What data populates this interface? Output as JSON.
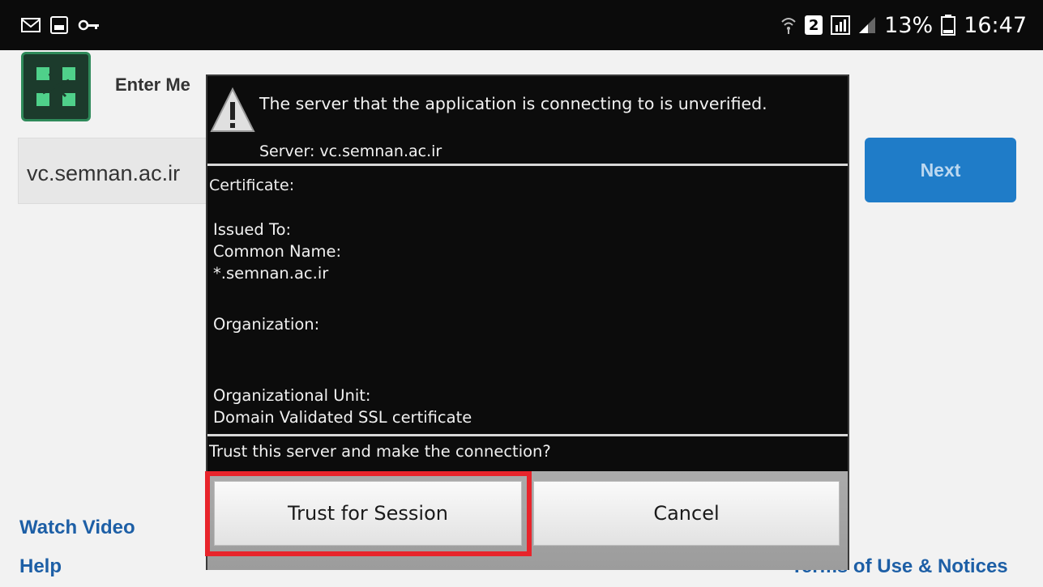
{
  "status_bar": {
    "battery": "13%",
    "time": "16:47",
    "sim_number": "2",
    "left_icons": [
      "mail-icon",
      "image-icon",
      "key-icon"
    ],
    "right_icons": [
      "wifi-icon",
      "sim-icon",
      "data-icon",
      "signal-icon",
      "battery-icon"
    ]
  },
  "app": {
    "title_visible": "Enter Me",
    "url_value": "vc.semnan.ac.ir",
    "next_label": "Next",
    "links": {
      "watch_video": "Watch Video",
      "help": "Help",
      "terms": "Terms of Use & Notices"
    }
  },
  "dialog": {
    "message": "The server that the application is connecting to is unverified.",
    "server_line": "Server: vc.semnan.ac.ir",
    "certificate_label": "Certificate:",
    "issued_to": "Issued To:",
    "common_name_label": "Common Name:",
    "common_name_value": "*.semnan.ac.ir",
    "organization_label": "Organization:",
    "org_unit_label": "Organizational Unit:",
    "org_unit_value": "Domain Validated SSL certificate",
    "trust_question": "Trust this server and make the connection?",
    "buttons": {
      "trust": "Trust for Session",
      "cancel": "Cancel"
    },
    "icon": "warning-icon"
  },
  "colors": {
    "highlight": "#e8242b",
    "link": "#1d5fa6",
    "next_button": "#1f7cc8"
  }
}
